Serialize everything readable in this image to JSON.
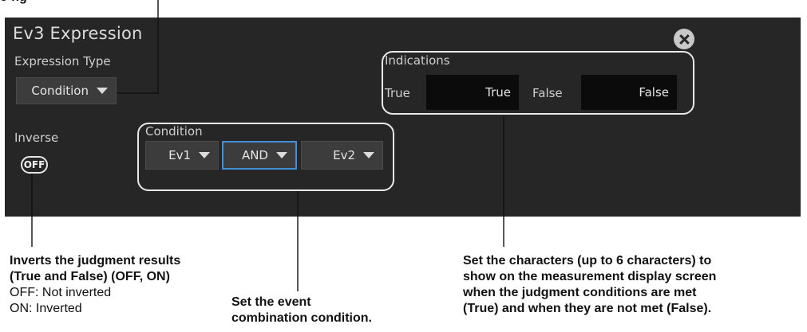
{
  "top_fragment": "e-ng",
  "window": {
    "title": "Ev3 Expression",
    "close_icon": "close-icon"
  },
  "expression_type": {
    "label": "Expression Type",
    "value": "Condition"
  },
  "inverse": {
    "label": "Inverse",
    "toggle": "OFF"
  },
  "condition": {
    "label": "Condition",
    "left_event": "Ev1",
    "operator": "AND",
    "right_event": "Ev2"
  },
  "indications": {
    "label": "Indications",
    "true_label": "True",
    "true_value": "True",
    "false_label": "False",
    "false_value": "False"
  },
  "annotations": {
    "inverse_title_1": "Inverts the judgment results",
    "inverse_title_2": "(True and False) (OFF, ON)",
    "inverse_off": "OFF: Not inverted",
    "inverse_on": "ON: Inverted",
    "condition_1": "Set the event",
    "condition_2": "combination condition.",
    "indications_1": "Set the characters (up to 6 characters) to",
    "indications_2": "show on the measurement display screen",
    "indications_3": "when the judgment conditions are met",
    "indications_4": "(True) and when they are not met (False)."
  },
  "colors": {
    "panel": "#262626",
    "accent": "#3f8fd9"
  }
}
